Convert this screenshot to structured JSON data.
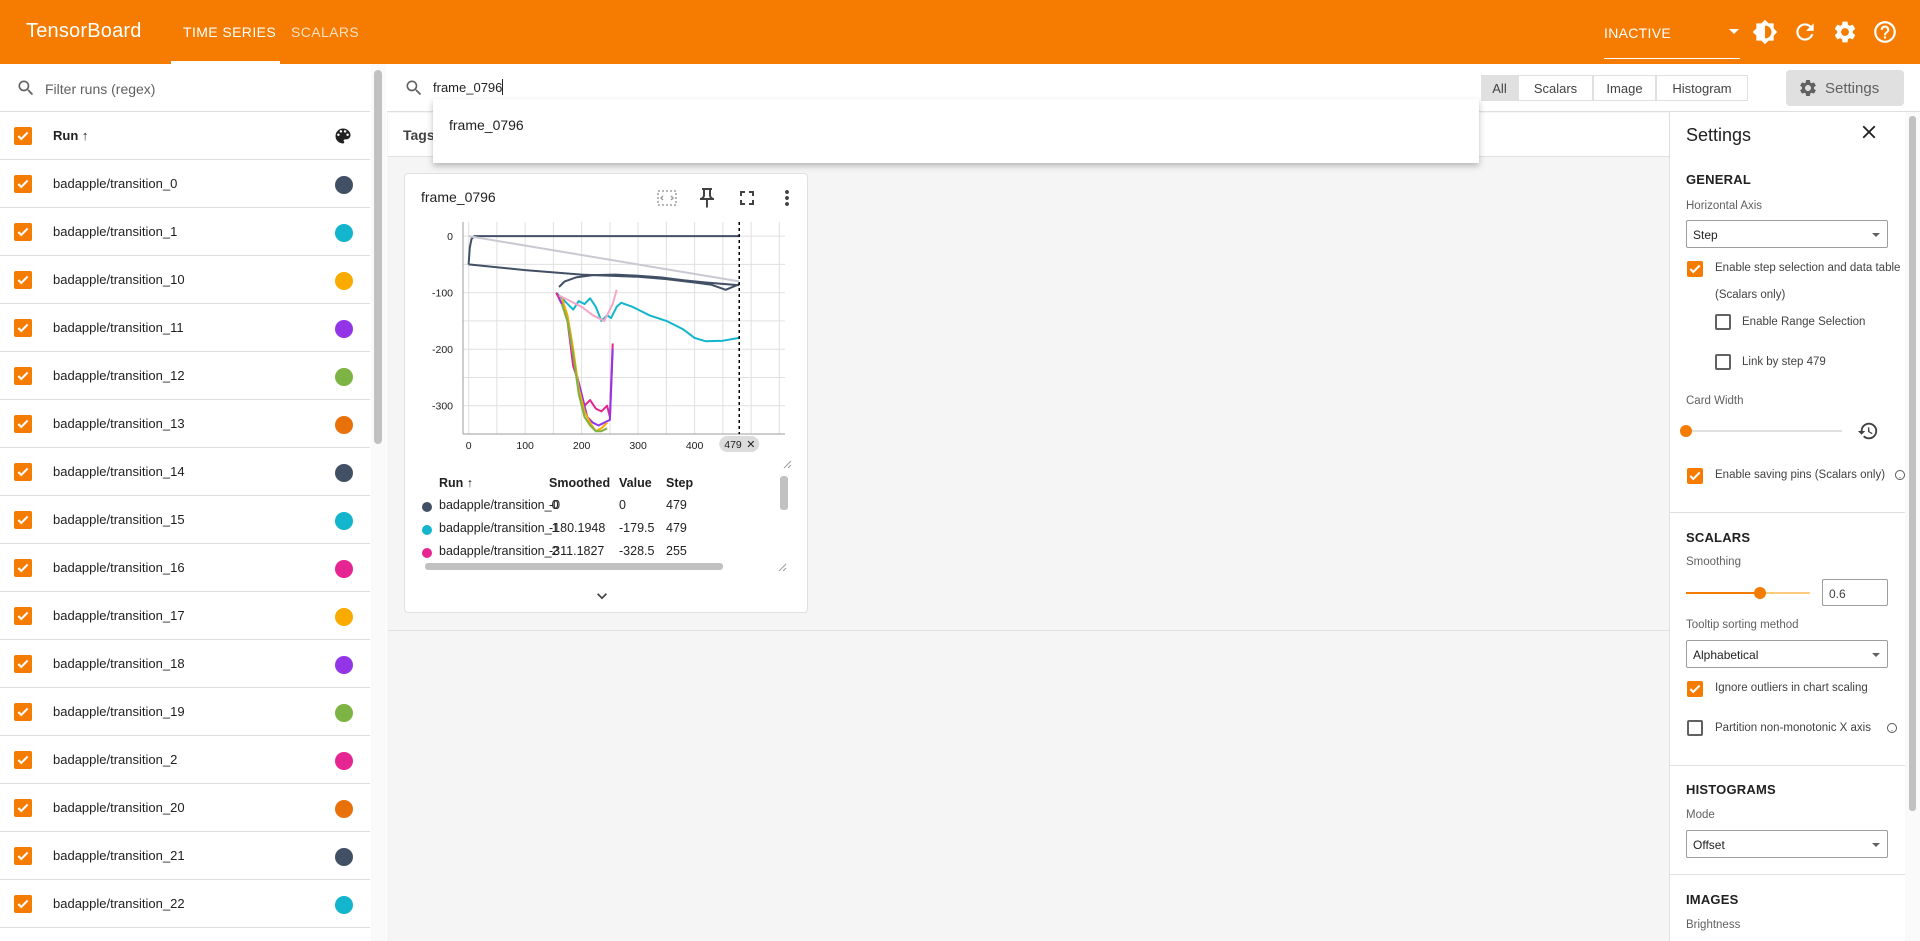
{
  "app": {
    "title": "TensorBoard",
    "tabs": [
      {
        "label": "TIME SERIES"
      },
      {
        "label": "SCALARS"
      }
    ],
    "status": "INACTIVE",
    "icons": [
      "brightness-icon",
      "refresh-icon",
      "settings-icon",
      "help-icon"
    ]
  },
  "runs_panel": {
    "filter_placeholder": "Filter runs (regex)",
    "header_label": "Run",
    "runs": [
      {
        "name": "badapple/transition_0",
        "color": "#425066"
      },
      {
        "name": "badapple/transition_1",
        "color": "#12b5cb"
      },
      {
        "name": "badapple/transition_10",
        "color": "#f9ab00"
      },
      {
        "name": "badapple/transition_11",
        "color": "#9334e6"
      },
      {
        "name": "badapple/transition_12",
        "color": "#7cb342"
      },
      {
        "name": "badapple/transition_13",
        "color": "#e8710a"
      },
      {
        "name": "badapple/transition_14",
        "color": "#425066"
      },
      {
        "name": "badapple/transition_15",
        "color": "#12b5cb"
      },
      {
        "name": "badapple/transition_16",
        "color": "#e52592"
      },
      {
        "name": "badapple/transition_17",
        "color": "#f9ab00"
      },
      {
        "name": "badapple/transition_18",
        "color": "#9334e6"
      },
      {
        "name": "badapple/transition_19",
        "color": "#7cb342"
      },
      {
        "name": "badapple/transition_2",
        "color": "#e52592"
      },
      {
        "name": "badapple/transition_20",
        "color": "#e8710a"
      },
      {
        "name": "badapple/transition_21",
        "color": "#425066"
      },
      {
        "name": "badapple/transition_22",
        "color": "#12b5cb"
      }
    ]
  },
  "search": {
    "query": "frame_0796",
    "suggestion": "frame_0796",
    "filters": [
      "All",
      "Scalars",
      "Image",
      "Histogram"
    ],
    "active_filter": "All",
    "settings_label": "Settings",
    "tags_label": "Tags"
  },
  "card": {
    "title": "frame_0796",
    "step_chip": "479",
    "table": {
      "headers": [
        "Run",
        "Smoothed",
        "Value",
        "Step"
      ],
      "rows": [
        {
          "run": "badapple/transition_0",
          "smoothed": "-0",
          "value": "0",
          "step": "479",
          "color": "#425066"
        },
        {
          "run": "badapple/transition_1",
          "smoothed": "-180.1948",
          "value": "-179.5",
          "step": "479",
          "color": "#12b5cb"
        },
        {
          "run": "badapple/transition_2",
          "smoothed": "-311.1827",
          "value": "-328.5",
          "step": "255",
          "color": "#e52592"
        }
      ]
    }
  },
  "chart_data": {
    "type": "line",
    "title": "frame_0796",
    "xlabel": "",
    "ylabel": "",
    "xlim": [
      -10,
      560
    ],
    "ylim": [
      -350,
      25
    ],
    "x_ticks": [
      0,
      100,
      200,
      300,
      400
    ],
    "y_ticks": [
      0,
      -100,
      -200,
      -300
    ],
    "grid": true,
    "selected_step": 479,
    "series": [
      {
        "color": "#425066",
        "x": [
          0,
          2,
          5,
          10,
          50,
          150,
          250,
          350,
          479
        ],
        "y": [
          -50,
          -20,
          -5,
          0,
          0,
          0,
          0,
          0,
          0
        ]
      },
      {
        "color": "#c8c9d2",
        "x": [
          0,
          479
        ],
        "y": [
          0,
          -80
        ]
      },
      {
        "color": "#425066",
        "x": [
          0,
          100,
          200,
          250,
          300,
          350,
          400,
          430,
          455,
          479
        ],
        "y": [
          -50,
          -60,
          -68,
          -70,
          -72,
          -76,
          -82,
          -86,
          -95,
          -85
        ]
      },
      {
        "color": "#425066",
        "x": [
          160,
          170,
          190,
          220,
          260,
          300,
          340,
          380,
          420,
          479
        ],
        "y": [
          -90,
          -80,
          -73,
          -69,
          -68,
          -70,
          -73,
          -78,
          -82,
          -87
        ]
      },
      {
        "color": "#12b5cb",
        "x": [
          155,
          170,
          185,
          195,
          205,
          215,
          225,
          235,
          245,
          252,
          262,
          270,
          290,
          320,
          350,
          380,
          400,
          420,
          450,
          479
        ],
        "y": [
          -100,
          -115,
          -130,
          -115,
          -120,
          -110,
          -125,
          -150,
          -140,
          -145,
          -125,
          -118,
          -125,
          -140,
          -150,
          -165,
          -180,
          -186,
          -185,
          -180
        ]
      },
      {
        "color": "#e52592",
        "x": [
          155,
          165,
          175,
          185,
          195,
          205,
          215,
          225,
          235,
          245,
          250,
          255
        ],
        "y": [
          -100,
          -120,
          -150,
          -230,
          -260,
          -300,
          -290,
          -305,
          -310,
          -300,
          -320,
          -190
        ]
      },
      {
        "color": "#9334e6",
        "x": [
          160,
          170,
          180,
          190,
          200,
          210,
          220,
          230,
          240,
          250,
          255
        ],
        "y": [
          -110,
          -130,
          -170,
          -240,
          -280,
          -320,
          -330,
          -335,
          -330,
          -325,
          -200
        ]
      },
      {
        "color": "#f9ab00",
        "x": [
          165,
          175,
          185,
          195,
          205,
          215,
          225,
          235,
          245
        ],
        "y": [
          -110,
          -140,
          -200,
          -270,
          -310,
          -330,
          -345,
          -340,
          -330
        ]
      },
      {
        "color": "#7cb342",
        "x": [
          165,
          175,
          185,
          195,
          205,
          215,
          225,
          235,
          245
        ],
        "y": [
          -120,
          -150,
          -210,
          -280,
          -320,
          -335,
          -345,
          -345,
          -340
        ]
      },
      {
        "color": "#f4a6c8",
        "x": [
          160,
          180,
          200,
          220,
          240,
          255,
          262
        ],
        "y": [
          -105,
          -115,
          -125,
          -140,
          -150,
          -120,
          -95
        ]
      }
    ]
  },
  "settings": {
    "title": "Settings",
    "general": {
      "heading": "GENERAL",
      "horizontal_axis_label": "Horizontal Axis",
      "horizontal_axis_value": "Step",
      "step_selection_label": "Enable step selection and data table",
      "step_selection_sub": "(Scalars only)",
      "range_selection_label": "Enable Range Selection",
      "link_by_step_label": "Link by step 479",
      "card_width_label": "Card Width",
      "card_width_level": 0,
      "saving_pins_label": "Enable saving pins (Scalars only)"
    },
    "scalars": {
      "heading": "SCALARS",
      "smoothing_label": "Smoothing",
      "smoothing_value": "0.6",
      "smoothing_level": 0.6,
      "tooltip_sort_label": "Tooltip sorting method",
      "tooltip_sort_value": "Alphabetical",
      "ignore_outliers_label": "Ignore outliers in chart scaling",
      "partition_label": "Partition non-monotonic X axis"
    },
    "histograms": {
      "heading": "HISTOGRAMS",
      "mode_label": "Mode",
      "mode_value": "Offset"
    },
    "images": {
      "heading": "IMAGES",
      "brightness_label": "Brightness"
    }
  }
}
